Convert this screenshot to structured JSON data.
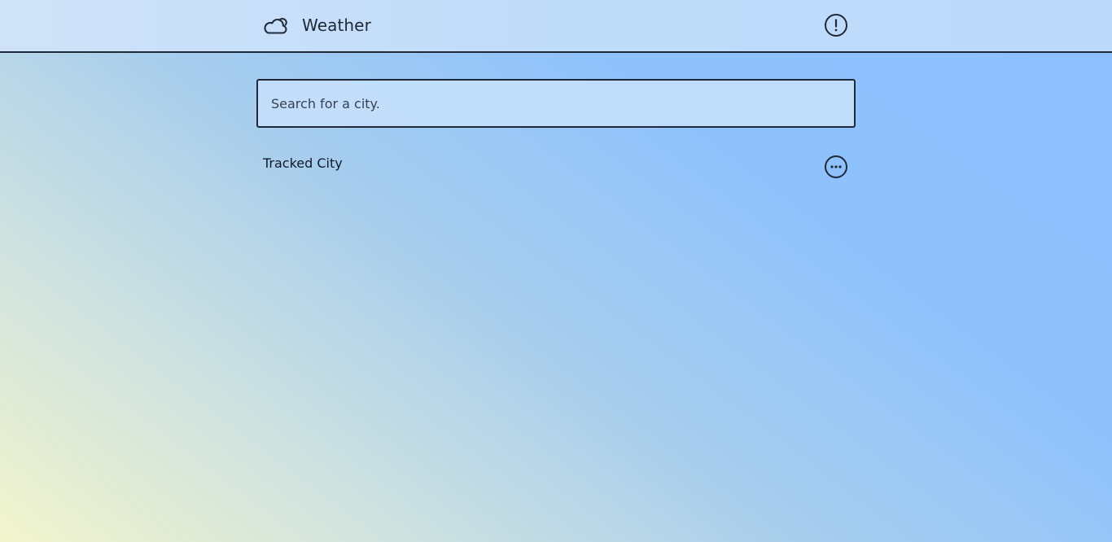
{
  "header": {
    "logo_icon": "cloud-sun-icon",
    "title": "Weather",
    "info_icon": "exclamation-circle-icon"
  },
  "search": {
    "placeholder": "Search for a city."
  },
  "tracked": {
    "label": "Tracked City",
    "more_icon": "ellipsis-circle-icon"
  },
  "colors": {
    "text": "#1f2937",
    "header_bg": "#c0dcfb",
    "gradient_light": "#f2f5cc",
    "gradient_blue": "#8dc0ff"
  }
}
